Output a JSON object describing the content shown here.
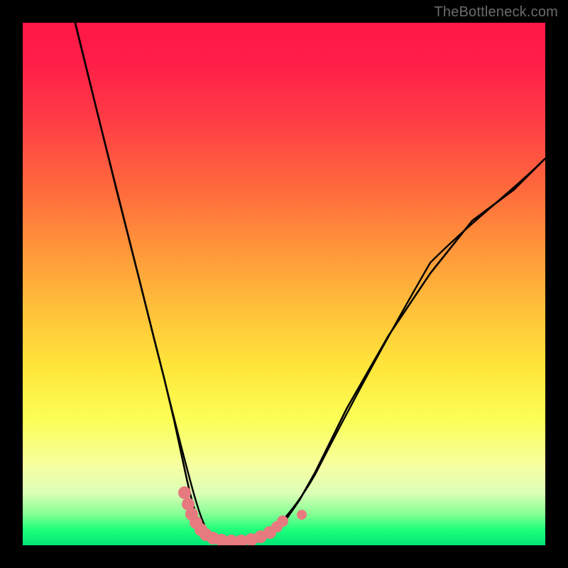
{
  "watermark": {
    "text": "TheBottleneck.com"
  },
  "chart_data": {
    "type": "line",
    "title": "",
    "xlabel": "",
    "ylabel": "",
    "xlim": [
      0,
      100
    ],
    "ylim": [
      0,
      100
    ],
    "series": [
      {
        "name": "curve",
        "x": [
          10,
          14,
          18,
          22,
          25,
          27,
          29,
          30.5,
          32,
          33.5,
          35,
          37,
          40,
          44,
          50,
          56,
          62,
          70,
          78,
          86,
          94,
          100
        ],
        "y": [
          100,
          84,
          68,
          52,
          40,
          32,
          24,
          17,
          11,
          6.5,
          3.5,
          1.8,
          0.8,
          0.8,
          2.0,
          6,
          14,
          26,
          40,
          54,
          66,
          74
        ]
      }
    ],
    "markers": [
      {
        "name": "dot-cluster-left",
        "x": [
          31,
          32,
          33,
          34,
          35
        ],
        "y": [
          10,
          7,
          5,
          3.5,
          2.5
        ]
      },
      {
        "name": "dot-cluster-base",
        "x": [
          36,
          38,
          40,
          42,
          44,
          46
        ],
        "y": [
          1.6,
          1.2,
          1.0,
          1.0,
          1.1,
          1.4
        ]
      },
      {
        "name": "dot-cluster-right",
        "x": [
          48,
          49,
          50
        ],
        "y": [
          2.0,
          2.5,
          3.2
        ]
      },
      {
        "name": "dot-isolated",
        "x": [
          53.5
        ],
        "y": [
          5.5
        ]
      }
    ],
    "colors": {
      "curve": "#000000",
      "marker": "#e77a7f",
      "gradient_top": "#ff1846",
      "gradient_bottom": "#00e676"
    }
  }
}
